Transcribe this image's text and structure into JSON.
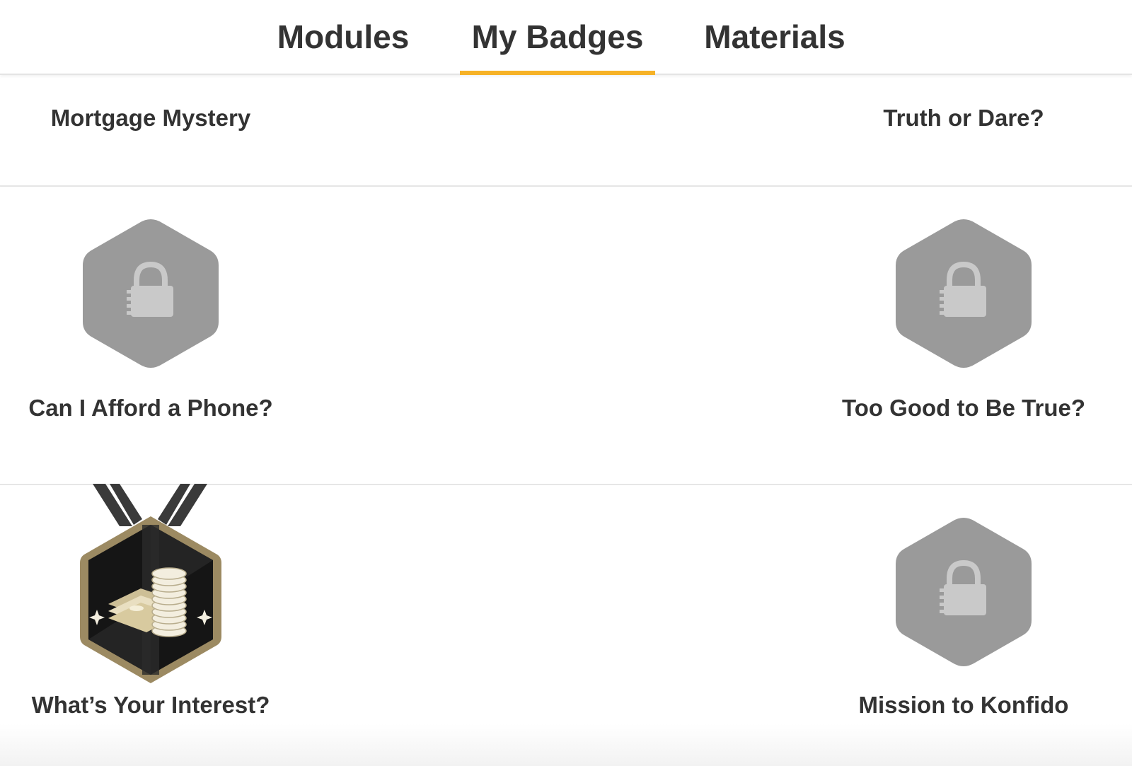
{
  "tabs": [
    {
      "label": "Modules",
      "active": false
    },
    {
      "label": "My Badges",
      "active": true
    },
    {
      "label": "Materials",
      "active": false
    }
  ],
  "accent_color": "#f6b227",
  "locked_badge_color": "#9a9a9a",
  "badges": [
    {
      "title": "Mortgage Mystery",
      "state": "locked"
    },
    {
      "title": "Truth or Dare?",
      "state": "locked"
    },
    {
      "title": "Can I Afford a Phone?",
      "state": "locked",
      "icon": "lock-icon"
    },
    {
      "title": "Too Good to Be True?",
      "state": "locked",
      "icon": "lock-icon"
    },
    {
      "title": "What’s Your Interest?",
      "state": "earned",
      "icon": "money-stack-medal-icon"
    },
    {
      "title": "Mission to Konfido",
      "state": "locked",
      "icon": "lock-icon"
    }
  ]
}
